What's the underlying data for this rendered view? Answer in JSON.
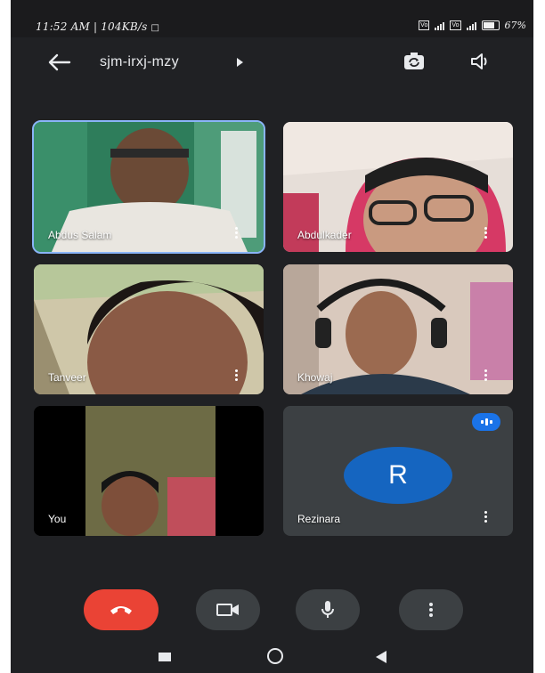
{
  "status_bar": {
    "time_speed": "11:52 AM | 104KB/s",
    "battery": "67"
  },
  "header": {
    "meeting_code": "sjm-irxj-mzy",
    "icons": [
      "back-arrow-icon",
      "caret-right-icon",
      "switch-camera-icon",
      "speaker-icon"
    ]
  },
  "participants": [
    {
      "name": "Abdus Salam",
      "active": true
    },
    {
      "name": "Abdulkader",
      "active": false
    },
    {
      "name": "Tanveer",
      "active": false
    },
    {
      "name": "Khowaj",
      "active": false
    },
    {
      "name": "You",
      "active": false
    },
    {
      "name": "Rezinara",
      "active": false,
      "avatar_letter": "R",
      "avatar_color": "#1565c0"
    }
  ],
  "controls": [
    "end-call-icon",
    "camera-icon",
    "mic-icon",
    "more-options-icon"
  ],
  "colors": {
    "background": "#202124",
    "end_call": "#ea4335",
    "control_bg": "#3c4043",
    "active_outline": "#8ab4f8",
    "badge": "#1a73e8"
  }
}
